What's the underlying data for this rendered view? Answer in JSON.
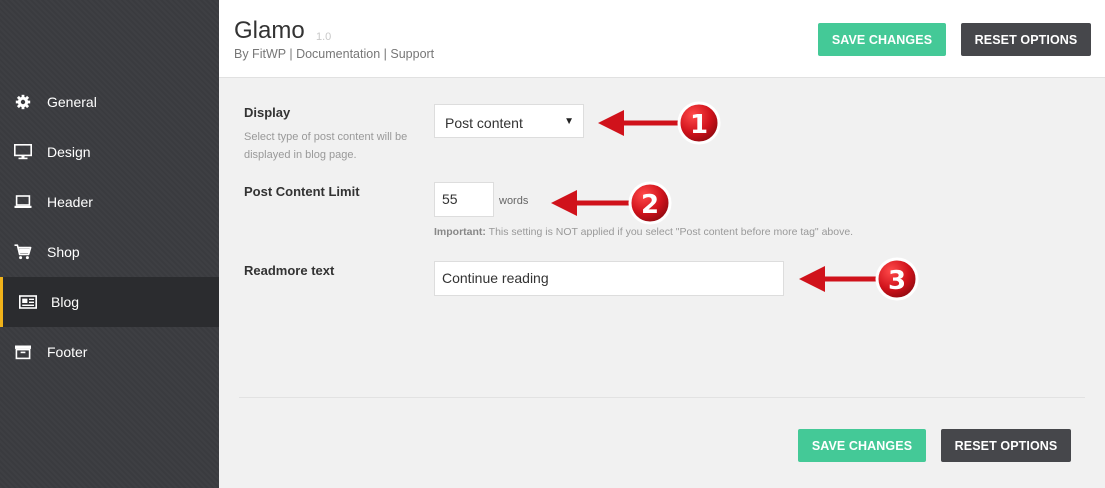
{
  "app": {
    "title": "Glamo",
    "version": "1.0",
    "author_link": "By FitWP",
    "separator": "|",
    "documentation_link": "Documentation",
    "support_link": "Support"
  },
  "actions": {
    "save_label": "SAVE CHANGES",
    "reset_label": "RESET OPTIONS"
  },
  "sidebar": {
    "items": [
      {
        "label": "General",
        "icon": "gear-icon"
      },
      {
        "label": "Design",
        "icon": "monitor-icon"
      },
      {
        "label": "Header",
        "icon": "laptop-icon"
      },
      {
        "label": "Shop",
        "icon": "cart-icon"
      },
      {
        "label": "Blog",
        "icon": "newspaper-icon",
        "active": true
      },
      {
        "label": "Footer",
        "icon": "archive-icon"
      }
    ]
  },
  "form": {
    "display": {
      "label": "Display",
      "description": "Select type of post content will be displayed in blog page.",
      "selected": "Post content"
    },
    "content_limit": {
      "label": "Post Content Limit",
      "value": "55",
      "unit": "words",
      "note_strong": "Important:",
      "note": " This setting is NOT applied if you select \"Post content before more tag\" above."
    },
    "readmore": {
      "label": "Readmore text",
      "value": "Continue reading"
    }
  },
  "annotations": {
    "markers": [
      "1",
      "2",
      "3"
    ],
    "arrow_color": "#d0121b"
  },
  "colors": {
    "sidebar_bg": "#3a3b3f",
    "active_item_bg": "#2b2c2f",
    "active_accent": "#f0b21a",
    "save_button": "#44c997",
    "reset_button": "#46474b"
  }
}
